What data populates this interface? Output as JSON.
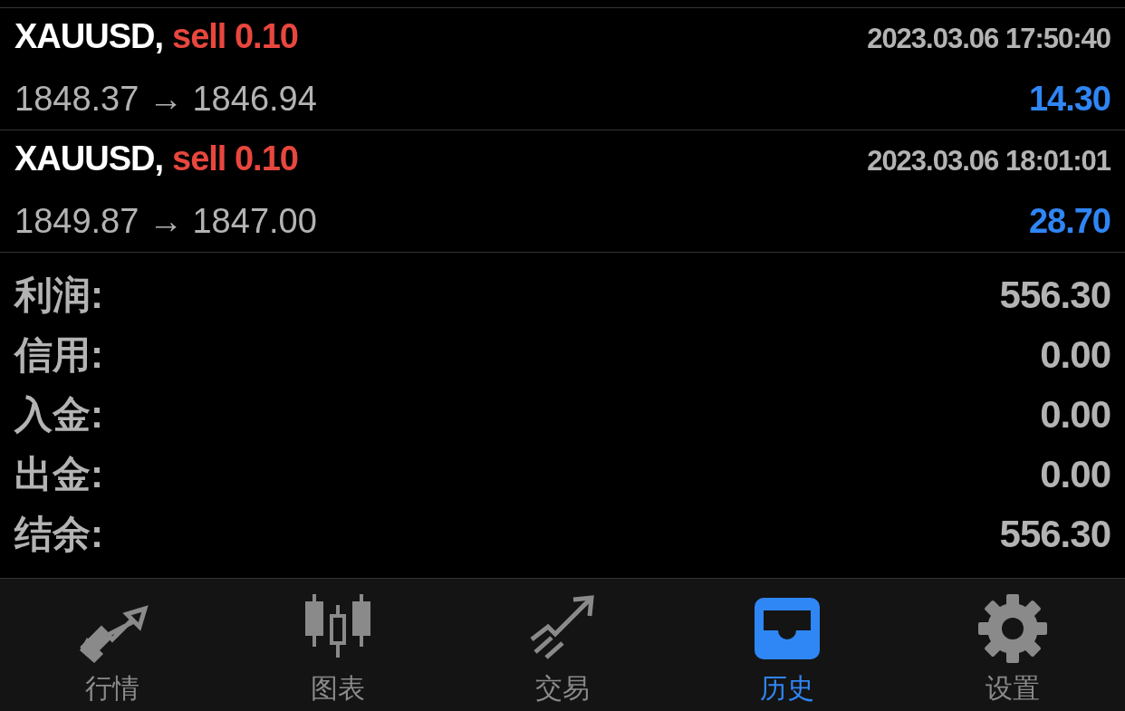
{
  "trades": [
    {
      "symbol": "XAUUSD,",
      "side": "sell 0.10",
      "time": "2023.03.06 17:50:40",
      "prices": "1848.37 → 1846.94",
      "profit": "14.30"
    },
    {
      "symbol": "XAUUSD,",
      "side": "sell 0.10",
      "time": "2023.03.06 18:01:01",
      "prices": "1849.87 → 1847.00",
      "profit": "28.70"
    }
  ],
  "summary": [
    {
      "label": "利润:",
      "value": "556.30"
    },
    {
      "label": "信用:",
      "value": "0.00"
    },
    {
      "label": "入金:",
      "value": "0.00"
    },
    {
      "label": "出金:",
      "value": "0.00"
    },
    {
      "label": "结余:",
      "value": "556.30"
    }
  ],
  "tabs": [
    {
      "kind": "quotes",
      "label": "行情",
      "selected": false
    },
    {
      "kind": "chart",
      "label": "图表",
      "selected": false
    },
    {
      "kind": "trade",
      "label": "交易",
      "selected": false
    },
    {
      "kind": "history",
      "label": "历史",
      "selected": true
    },
    {
      "kind": "settings",
      "label": "设置",
      "selected": false
    }
  ]
}
